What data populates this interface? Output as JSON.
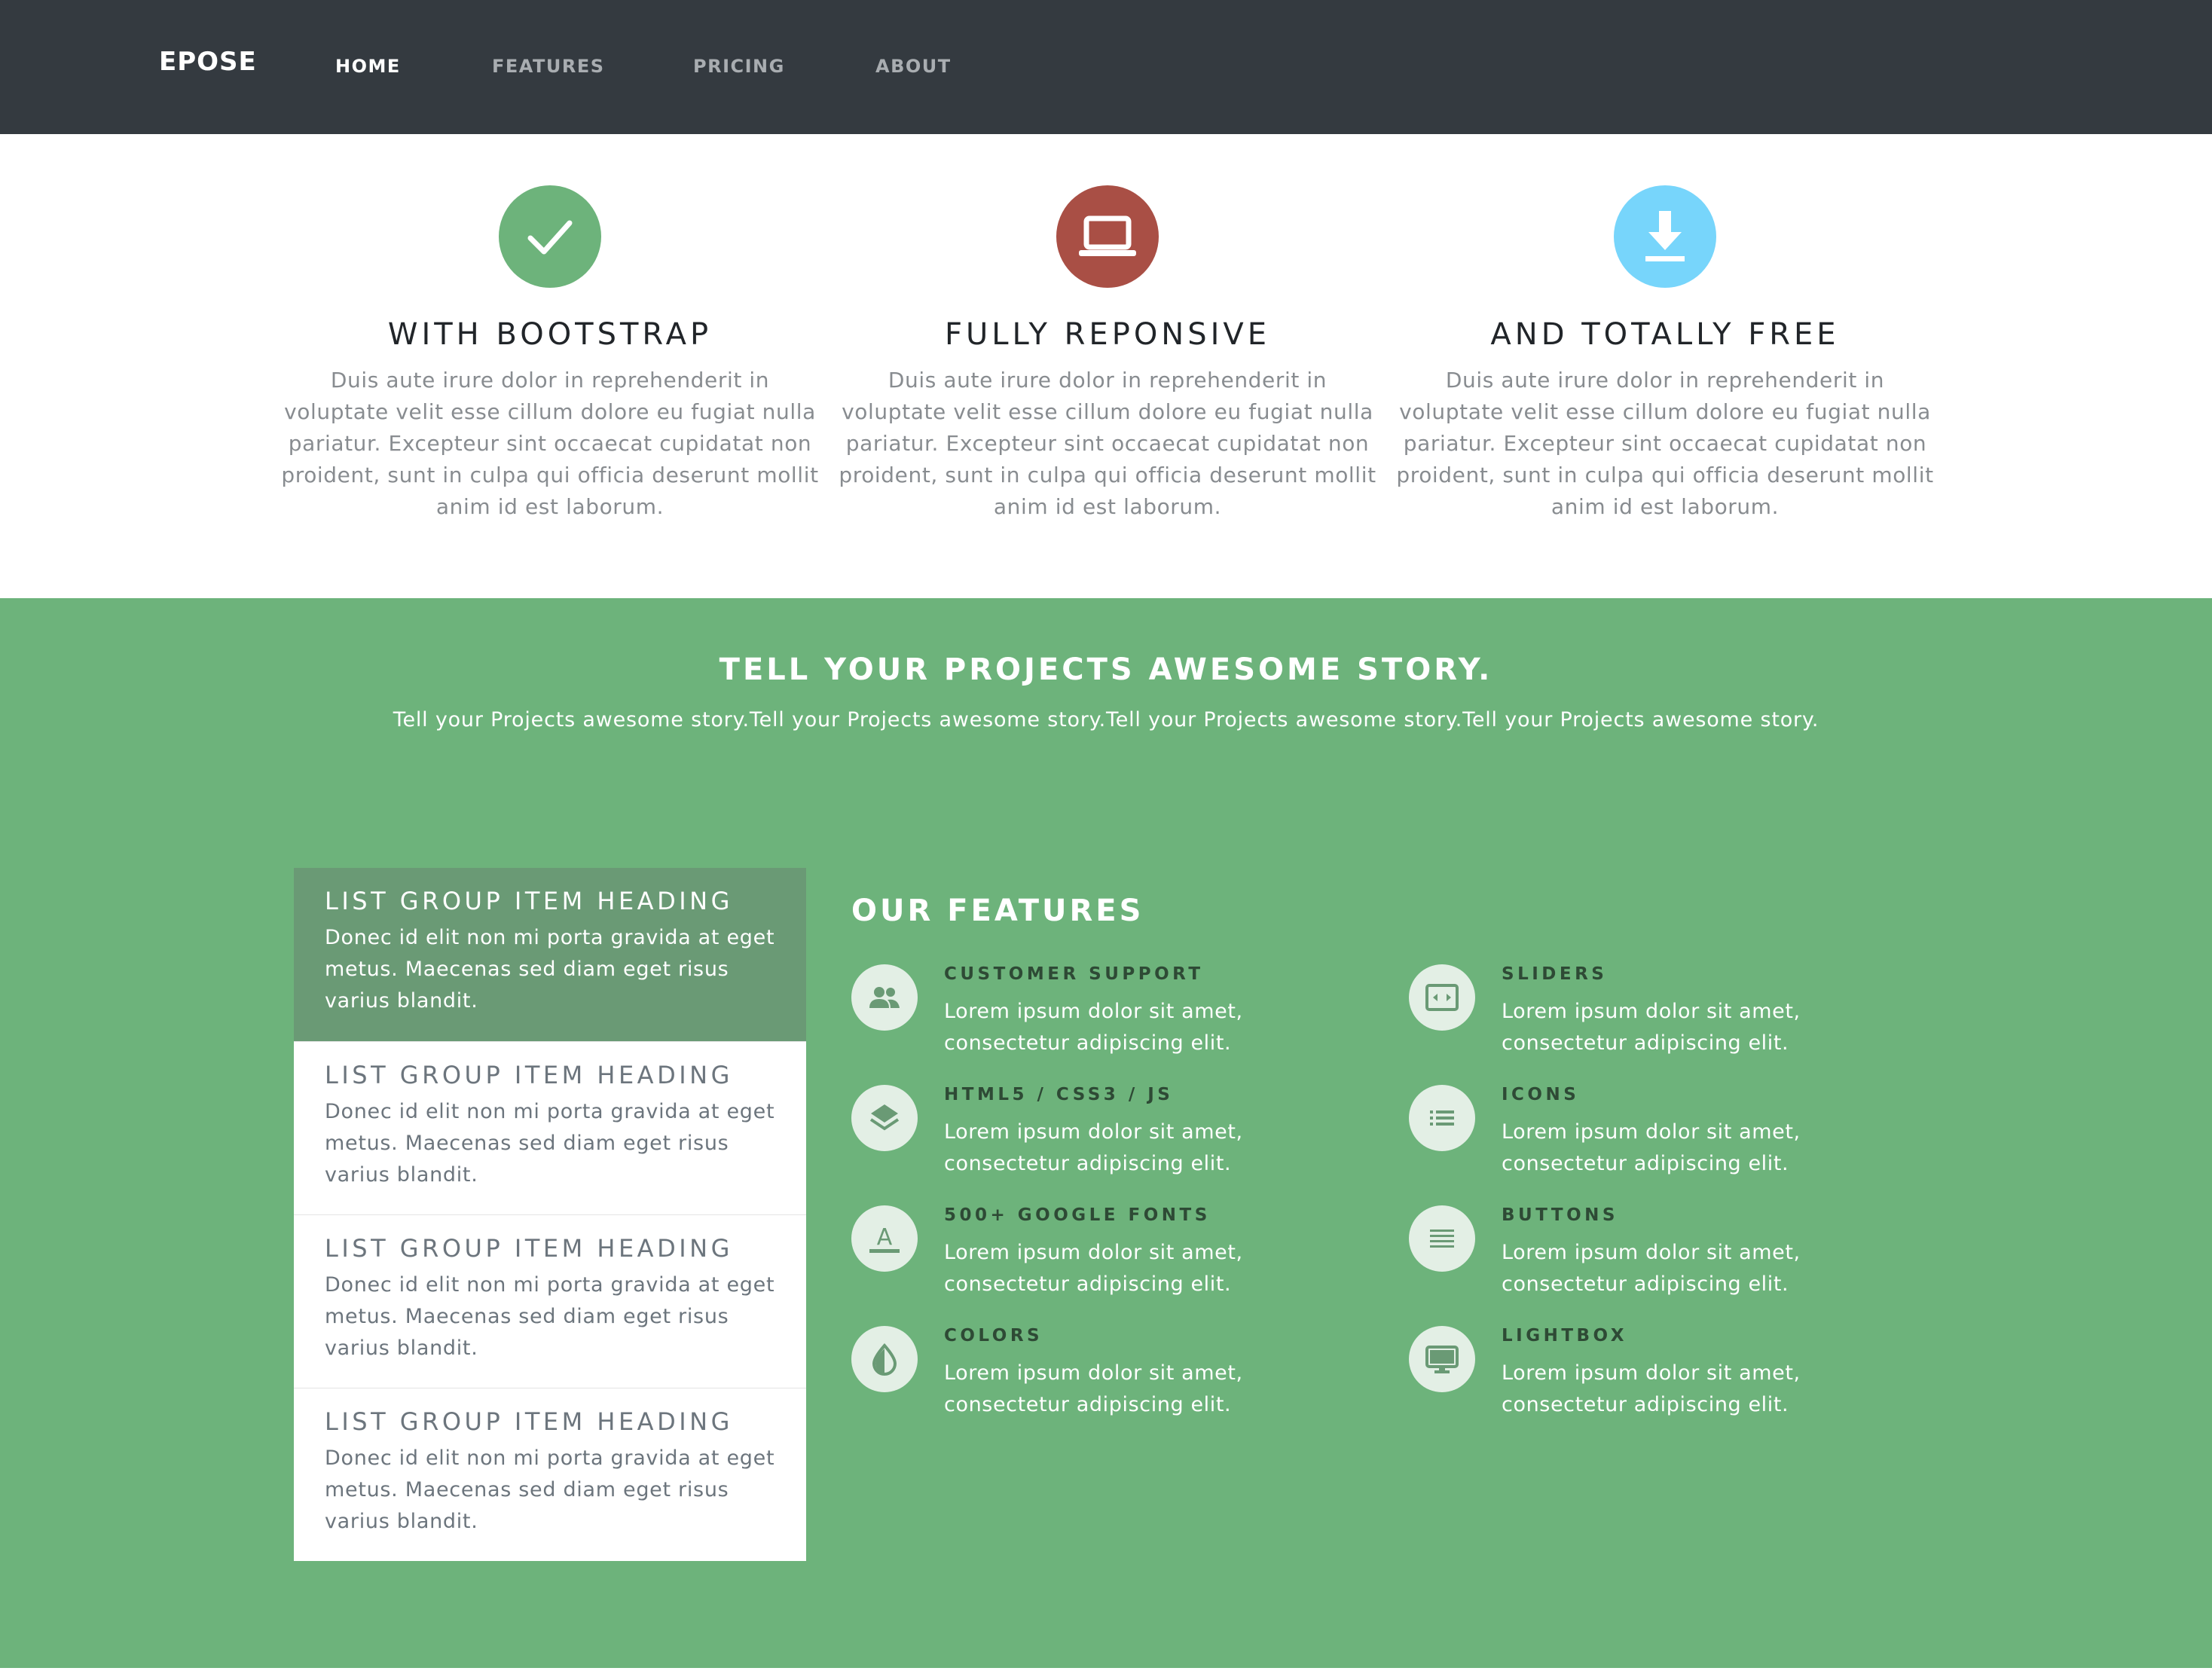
{
  "navbar": {
    "brand": "EPOSE",
    "links": [
      {
        "label": "HOME",
        "active": true
      },
      {
        "label": "FEATURES",
        "active": false
      },
      {
        "label": "PRICING",
        "active": false
      },
      {
        "label": "ABOUT",
        "active": false
      }
    ]
  },
  "intro": {
    "columns": [
      {
        "icon": "check-icon",
        "icon_color": "#6db37b",
        "heading": "WITH BOOTSTRAP",
        "text": "Duis aute irure dolor in reprehenderit in voluptate velit esse cillum dolore eu fugiat nulla pariatur. Excepteur sint occaecat cupidatat non proident, sunt in culpa qui officia deserunt mollit anim id est laborum."
      },
      {
        "icon": "laptop-icon",
        "icon_color": "#a94f45",
        "heading": "FULLY REPONSIVE",
        "text": "Duis aute irure dolor in reprehenderit in voluptate velit esse cillum dolore eu fugiat nulla pariatur. Excepteur sint occaecat cupidatat non proident, sunt in culpa qui officia deserunt mollit anim id est laborum."
      },
      {
        "icon": "download-icon",
        "icon_color": "#77d5fb",
        "heading": "AND TOTALLY FREE",
        "text": "Duis aute irure dolor in reprehenderit in voluptate velit esse cillum dolore eu fugiat nulla pariatur. Excepteur sint occaecat cupidatat non proident, sunt in culpa qui officia deserunt mollit anim id est laborum."
      }
    ]
  },
  "story": {
    "title": "TELL YOUR PROJECTS AWESOME STORY.",
    "subtitle": "Tell your Projects awesome story.Tell your Projects awesome story.Tell your Projects awesome story.Tell your Projects awesome story."
  },
  "list_group": {
    "items": [
      {
        "heading": "LIST GROUP ITEM HEADING",
        "text": "Donec id elit non mi porta gravida at eget metus. Maecenas sed diam eget risus varius blandit.",
        "active": true
      },
      {
        "heading": "LIST GROUP ITEM HEADING",
        "text": "Donec id elit non mi porta gravida at eget metus. Maecenas sed diam eget risus varius blandit.",
        "active": false
      },
      {
        "heading": "LIST GROUP ITEM HEADING",
        "text": "Donec id elit non mi porta gravida at eget metus. Maecenas sed diam eget risus varius blandit.",
        "active": false
      },
      {
        "heading": "LIST GROUP ITEM HEADING",
        "text": "Donec id elit non mi porta gravida at eget metus. Maecenas sed diam eget risus varius blandit.",
        "active": false
      }
    ]
  },
  "features": {
    "title": "OUR FEATURES",
    "items": [
      {
        "icon": "users-icon",
        "label": "CUSTOMER SUPPORT",
        "text": "Lorem ipsum dolor sit amet, consectetur adipiscing elit."
      },
      {
        "icon": "layers-icon",
        "label": "HTML5 / CSS3 / JS",
        "text": "Lorem ipsum dolor sit amet, consectetur adipiscing elit."
      },
      {
        "icon": "font-icon",
        "label": "500+ GOOGLE FONTS",
        "text": "Lorem ipsum dolor sit amet, consectetur adipiscing elit."
      },
      {
        "icon": "colors-icon",
        "label": "COLORS",
        "text": "Lorem ipsum dolor sit amet, consectetur adipiscing elit."
      },
      {
        "icon": "slider-icon",
        "label": "SLIDERS",
        "text": "Lorem ipsum dolor sit amet, consectetur adipiscing elit."
      },
      {
        "icon": "list-icon",
        "label": "ICONS",
        "text": "Lorem ipsum dolor sit amet, consectetur adipiscing elit."
      },
      {
        "icon": "menu-lines-icon",
        "label": "BUTTONS",
        "text": "Lorem ipsum dolor sit amet, consectetur adipiscing elit."
      },
      {
        "icon": "monitor-icon",
        "label": "LIGHTBOX",
        "text": "Lorem ipsum dolor sit amet, consectetur adipiscing elit."
      }
    ]
  },
  "colors": {
    "navbar_bg": "#343a40",
    "green_bg": "#6db37b",
    "list_active_bg": "#6a9a75"
  }
}
